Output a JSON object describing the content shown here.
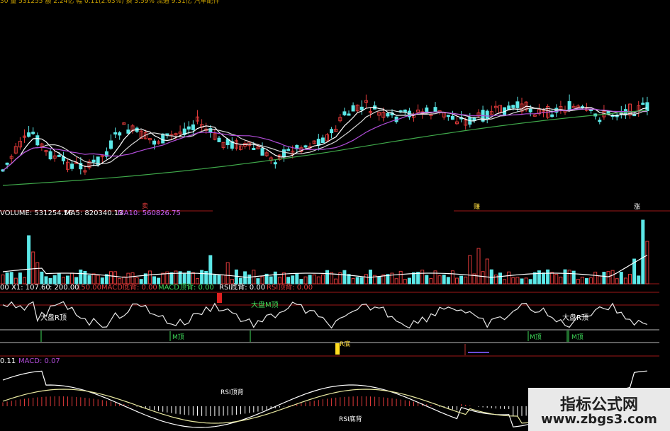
{
  "header": {
    "text": "30 量 531255 额 2.24亿 幅 0.11(2.63%) 换 3.59% 流通 9.31亿 汽车配件"
  },
  "volume_bar": {
    "label": "VOLUME: 531254.56",
    "ma5": "MA5: 820340.13",
    "ma10": "MA10: 560826.75",
    "color_vol": "#ffffff",
    "color_ma10": "#d065ff"
  },
  "signal_bar": {
    "prefix": "00",
    "x1": "X1: 107.60",
    "v200": ": 200.00",
    "v150": "150.00",
    "macd_bottom": "MACD底背: 0.00",
    "macd_top": "MACD顶背: 0.00",
    "rsi_bottom": "RSI底背: 0.00",
    "rsi_top": "RSI顶背: 0.00"
  },
  "macd_bar": {
    "prefix": "0.11",
    "label": "MACD: 0.07"
  },
  "annotations": {
    "sell_marker_1": "卖",
    "buy_marker": "赚",
    "sell_marker_2": "涨",
    "dapan_r_top_1": "大盘R顶",
    "dapan_m_top": "大盘M顶",
    "dapan_r_top_2": "大盘R顶",
    "m_top_1": "M顶",
    "r_bottom": "R底",
    "m_top_2": "M顶",
    "m_top_3": "M顶",
    "rsi_top_div": "RSI顶背",
    "rsi_bottom_div": "RSI底背"
  },
  "watermark": {
    "line1": "指标公式网",
    "line2": "www.zbgs3.com"
  },
  "colors": {
    "up": "#e03a3a",
    "down": "#5ce8e8",
    "ma_white": "#ffffff",
    "ma_purple": "#b04cd8",
    "ma_green": "#3fa84a",
    "divider": "#a01818",
    "grid_white": "#d8d8d8"
  }
}
